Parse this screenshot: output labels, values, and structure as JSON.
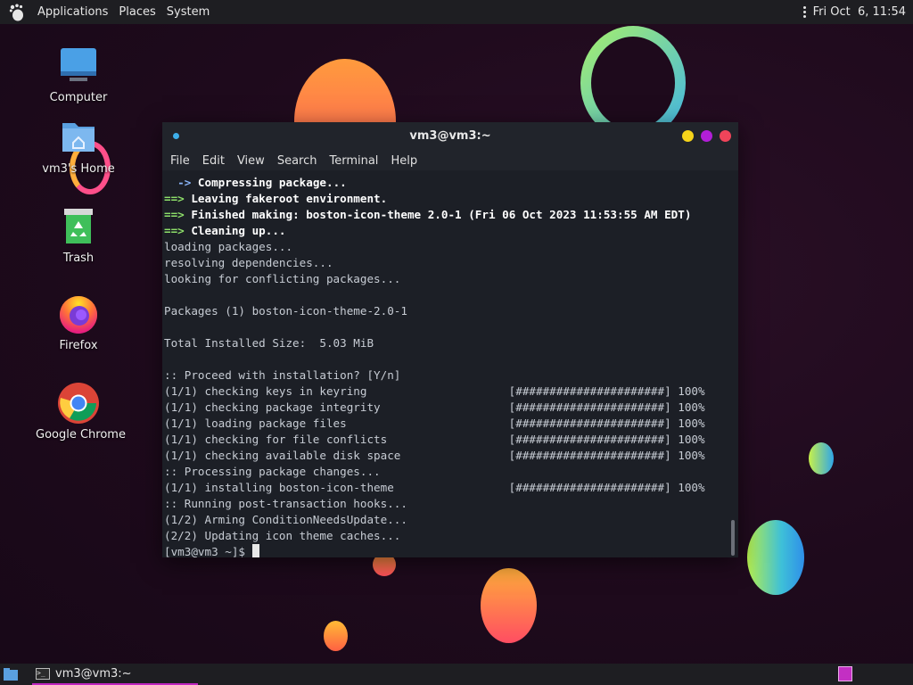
{
  "top_panel": {
    "menus": [
      "Applications",
      "Places",
      "System"
    ],
    "clock": "Fri Oct  6, 11:54"
  },
  "desktop_icons": [
    {
      "label": "Computer",
      "icon": "computer-icon"
    },
    {
      "label": "vm3's Home",
      "icon": "home-folder-icon"
    },
    {
      "label": "Trash",
      "icon": "trash-icon"
    },
    {
      "label": "Firefox",
      "icon": "firefox-icon"
    },
    {
      "label": "Google Chrome",
      "icon": "chrome-icon"
    }
  ],
  "terminal": {
    "title": "vm3@vm3:~",
    "menu": [
      "File",
      "Edit",
      "View",
      "Search",
      "Terminal",
      "Help"
    ],
    "lines": [
      {
        "prefix": "  ->",
        "text": " Compressing package...",
        "style": "bold"
      },
      {
        "prefix": "==>",
        "text": " Leaving fakeroot environment.",
        "style": "bold"
      },
      {
        "prefix": "==>",
        "text": " Finished making: boston-icon-theme 2.0-1 (Fri 06 Oct 2023 11:53:55 AM EDT)",
        "style": "bold"
      },
      {
        "prefix": "==>",
        "text": " Cleaning up...",
        "style": "bold"
      },
      {
        "prefix": "",
        "text": "loading packages...",
        "style": "normal"
      },
      {
        "prefix": "",
        "text": "resolving dependencies...",
        "style": "normal"
      },
      {
        "prefix": "",
        "text": "looking for conflicting packages...",
        "style": "normal"
      },
      {
        "prefix": "",
        "text": "",
        "style": "normal"
      },
      {
        "prefix": "",
        "text": "Packages (1) boston-icon-theme-2.0-1",
        "style": "normal"
      },
      {
        "prefix": "",
        "text": "",
        "style": "normal"
      },
      {
        "prefix": "",
        "text": "Total Installed Size:  5.03 MiB",
        "style": "normal"
      },
      {
        "prefix": "",
        "text": "",
        "style": "normal"
      },
      {
        "prefix": "",
        "text": ":: Proceed with installation? [Y/n]",
        "style": "normal"
      },
      {
        "prefix": "",
        "text": "(1/1) checking keys in keyring                     [######################] 100%",
        "style": "normal"
      },
      {
        "prefix": "",
        "text": "(1/1) checking package integrity                   [######################] 100%",
        "style": "normal"
      },
      {
        "prefix": "",
        "text": "(1/1) loading package files                        [######################] 100%",
        "style": "normal"
      },
      {
        "prefix": "",
        "text": "(1/1) checking for file conflicts                  [######################] 100%",
        "style": "normal"
      },
      {
        "prefix": "",
        "text": "(1/1) checking available disk space                [######################] 100%",
        "style": "normal"
      },
      {
        "prefix": "",
        "text": ":: Processing package changes...",
        "style": "normal"
      },
      {
        "prefix": "",
        "text": "(1/1) installing boston-icon-theme                 [######################] 100%",
        "style": "normal"
      },
      {
        "prefix": "",
        "text": ":: Running post-transaction hooks...",
        "style": "normal"
      },
      {
        "prefix": "",
        "text": "(1/2) Arming ConditionNeedsUpdate...",
        "style": "normal"
      },
      {
        "prefix": "",
        "text": "(2/2) Updating icon theme caches...",
        "style": "normal"
      }
    ],
    "prompt": "[vm3@vm3 ~]$ "
  },
  "taskbar": {
    "task_label": "vm3@vm3:~"
  },
  "colors": {
    "accent": "#c026c0",
    "prompt_arrow": "#8ee06a",
    "btn_yellow": "#f5d31a",
    "btn_purple": "#b21ed8",
    "btn_red": "#f0445a"
  }
}
